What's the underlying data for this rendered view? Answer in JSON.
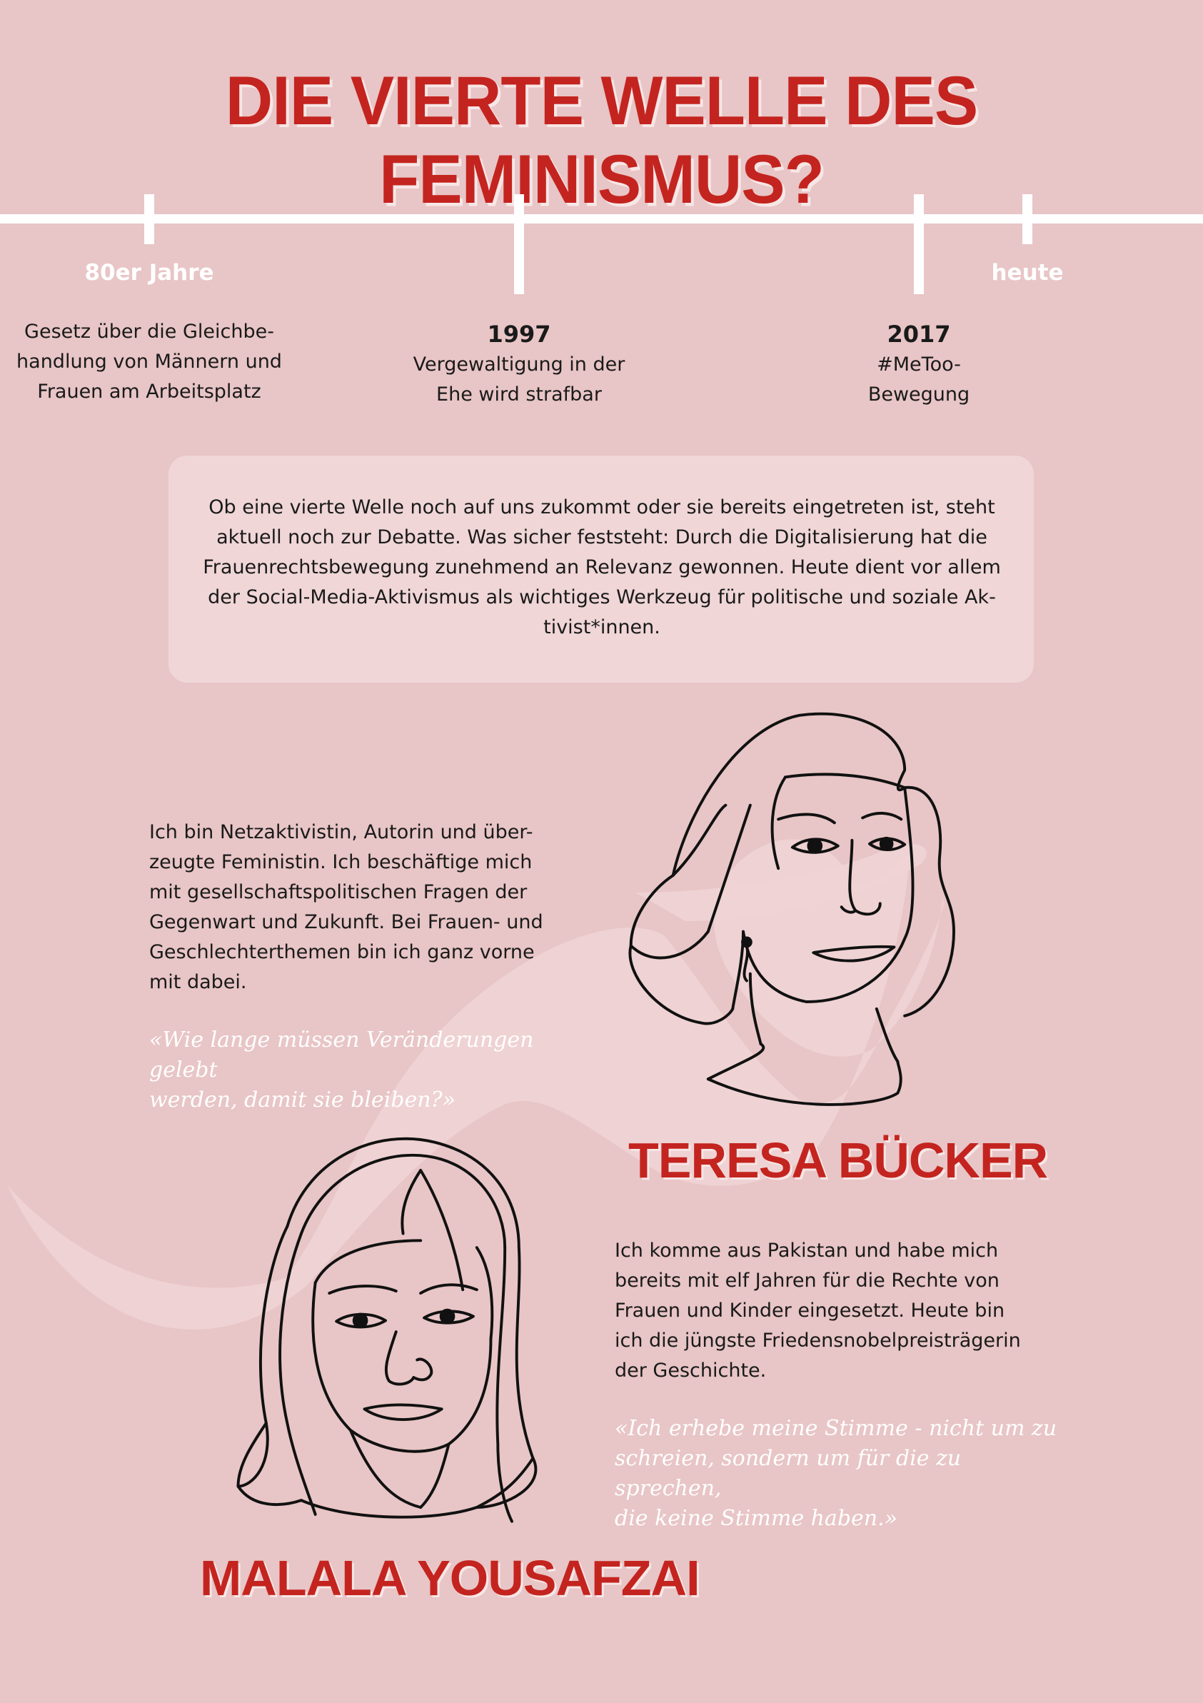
{
  "title": "DIE VIERTE WELLE DES FEMINISMUS?",
  "timeline": {
    "start_label": "80er Jahre",
    "end_label": "heute",
    "events": [
      {
        "year": "",
        "text": "Gesetz über die Gleichbe-\nhandlung von Männern und\nFrauen am Arbeitsplatz"
      },
      {
        "year": "1997",
        "text": "Vergewaltigung in der\nEhe wird strafbar"
      },
      {
        "year": "2017",
        "text": "#MeToo-\nBewegung"
      }
    ]
  },
  "intro": "Ob eine vierte Welle noch auf uns zukommt oder sie bereits eingetreten ist, steht aktuell noch zur Debatte. Was sicher feststeht: Durch die Digitalisierung hat die Frauenrechtsbewegung zunehmend an Relevanz gewonnen. Heute dient vor allem der Social-Media-Aktivismus als wichtiges Werkzeug für politische und soziale Ak-tivist*innen.",
  "people": [
    {
      "name": "TERESA BÜCKER",
      "bio": "Ich bin Netzaktivistin, Autorin und über-\nzeugte Feministin. Ich beschäftige mich\nmit gesellschaftspolitischen Fragen der\nGegenwart und Zukunft. Bei Frauen- und\nGeschlechterthemen bin ich ganz vorne\nmit dabei.",
      "quote": "«Wie lange müssen Veränderungen gelebt\nwerden, damit sie bleiben?»"
    },
    {
      "name": "MALALA YOUSAFZAI",
      "bio": "Ich komme aus Pakistan und habe mich\nbereits mit elf Jahren für die Rechte von\nFrauen und Kinder eingesetzt. Heute bin\nich die jüngste Friedensnobelpreisträgerin\nder Geschichte.",
      "quote": "«Ich erhebe meine Stimme - nicht um zu\nschreien, sondern um für die zu sprechen,\ndie keine Stimme haben.»"
    }
  ],
  "colors": {
    "background": "#e8c5c6",
    "accent_red": "#c4241f",
    "box": "#f0d6d7",
    "wave": "#f0d6d7",
    "white": "#ffffff"
  },
  "icons": {
    "portrait_1": "line-art-woman-portrait",
    "portrait_2": "line-art-woman-with-headscarf-portrait",
    "background_wave": "decorative-wave"
  }
}
